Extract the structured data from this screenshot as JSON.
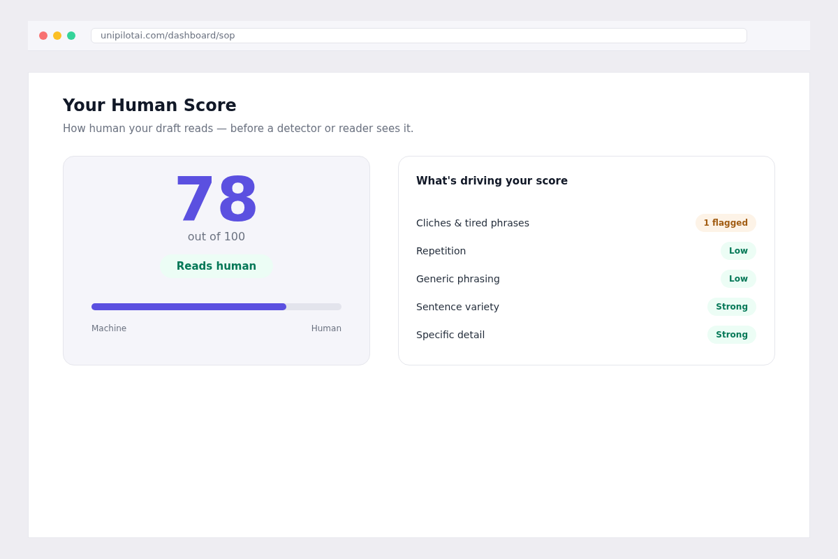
{
  "browser": {
    "url": "unipilotai.com/dashboard/sop"
  },
  "page": {
    "title": "Your Human Score",
    "subtitle": "How human your draft reads — before a detector or reader sees it."
  },
  "score_card": {
    "score": "78",
    "scale": "out of 100",
    "verdict": "Reads human",
    "meter": {
      "level": 0.78,
      "min_label": "Machine",
      "max_label": "Human"
    }
  },
  "drivers": {
    "title": "What's driving your score",
    "items": [
      {
        "label": "Cliches & tired phrases",
        "rating": "1 flagged",
        "kind": "warning"
      },
      {
        "label": "Repetition",
        "rating": "Low",
        "kind": "good"
      },
      {
        "label": "Generic phrasing",
        "rating": "Low",
        "kind": "good"
      },
      {
        "label": "Sentence variety",
        "rating": "Strong",
        "kind": "good"
      },
      {
        "label": "Specific detail",
        "rating": "Strong",
        "kind": "good"
      }
    ]
  }
}
